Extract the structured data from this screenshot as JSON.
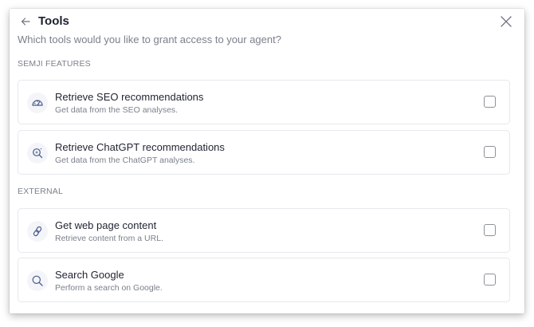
{
  "header": {
    "title": "Tools",
    "back_icon": "arrow-left-icon",
    "close_icon": "close-icon"
  },
  "subtitle": "Which tools would you like to grant access to your agent?",
  "sections": [
    {
      "label": "SEMJI FEATURES",
      "tools": [
        {
          "title": "Retrieve SEO recommendations",
          "description": "Get data from the SEO analyses.",
          "icon": "gauge-icon",
          "checked": false
        },
        {
          "title": "Retrieve ChatGPT recommendations",
          "description": "Get data from the ChatGPT analyses.",
          "icon": "sparkle-search-icon",
          "checked": false
        }
      ]
    },
    {
      "label": "EXTERNAL",
      "tools": [
        {
          "title": "Get web page content",
          "description": "Retrieve content from a URL.",
          "icon": "link-icon",
          "checked": false
        },
        {
          "title": "Search Google",
          "description": "Perform a search on Google.",
          "icon": "search-icon",
          "checked": false
        }
      ]
    }
  ],
  "colors": {
    "title": "#1c2030",
    "muted_text": "#7a808c",
    "card_border": "#e6e8ec",
    "icon_bg": "#f3f5f9",
    "icon_stroke": "#4a5a8a",
    "checkbox_border": "#8c919b"
  }
}
